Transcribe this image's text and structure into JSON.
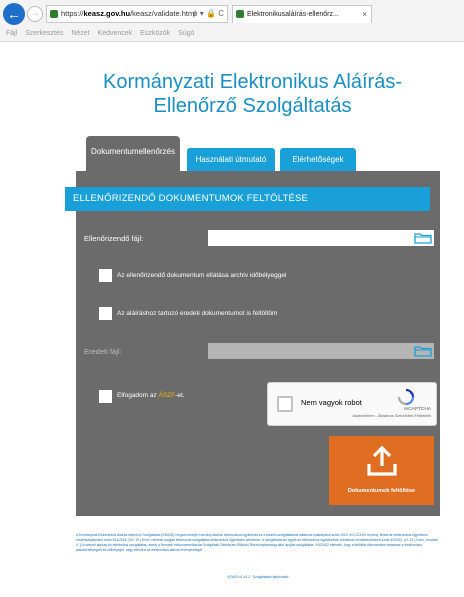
{
  "browser": {
    "url_prefix": "https://",
    "url_host": "keasz.gov.hu",
    "url_path": "/keasz/validate.html",
    "url_tools": "ρ ▾ 🔒 C",
    "tab_title": "Elektronikusaláírás-ellenőrz...",
    "tab_close": "×",
    "menu": [
      "Fájl",
      "Szerkesztés",
      "Nézet",
      "Kedvencek",
      "Eszközök",
      "Súgó"
    ]
  },
  "page": {
    "title_line1": "Kormányzati Elektronikus Aláírás-",
    "title_line2": "Ellenőrző Szolgáltatás"
  },
  "tabs": {
    "doc_check": "Dokumentumellenőrzés",
    "help": "Használati útmutató",
    "contact": "Elérhetőségek"
  },
  "form": {
    "section_title": "ELLENŐRIZENDŐ DOKUMENTUMOK FELTÖLTÉSE",
    "file_label": "Ellenőrizendő fájl:",
    "archive_label": "Az ellenőrizendő dokumentum ellátása archív időbélyeggel",
    "original_label": "Az aláíráshoz tartozó eredeti dokumentumot is feltöltöm",
    "original_file_label": "Eredeti fájl:",
    "accept_prefix": "Elfogadom az ",
    "accept_link": "ÁSZF",
    "accept_suffix": "-et.",
    "upload_button": "Dokumentumok feltöltése"
  },
  "captcha": {
    "label": "Nem vagyok robot",
    "brand": "reCAPTCHA",
    "links": "Adatvédelem - Általános Szerződési Feltételek"
  },
  "footer": {
    "text": "A Kormányzati Elektronikus Aláírás-ellenőrző Szolgáltatás (KEASZ) megszervezője Kormány által az elektronikus ügyintézés és a bizalmi szolgáltatások általános szabályairól szóló 2015. évi CCXXII. törvény, illetve az elektronikus ügyintézés részletszabályairól szóló 451/2016. (XII. 19.) Korm. rendelet alapján létrehozott szolgáltatás elektronikus ügyintézés keretében. A szolgáltatás az egyes az elektronikus ügyintézésre vonatkozó rendelkezésekről szóló 84/2012. (IV. 21.) Korm. rendelet 4. §-a szerinti aláírási és hitelesítési szolgáltatás, amely a Nemzeti Infokommunikációs Szolgáltató Zártkörűen Működő Részvénytársaság által nyújtott szolgáltatás. A KEASZ elérhető, hogy a feltöltött dokumentum tartalmaz-e elektronikus aláírást/bélyegzőt és időbélyeget, vagy ellenőrzi az elektronikus aláírás érvényességét.",
    "version": "KEASZ v1.43.2 · Szolgáltatási tájékoztató"
  },
  "colors": {
    "accent": "#1aa0d8",
    "panel": "#6b6b6b",
    "title": "#1a8fc5",
    "button": "#e06e22",
    "link": "#f5b400"
  }
}
